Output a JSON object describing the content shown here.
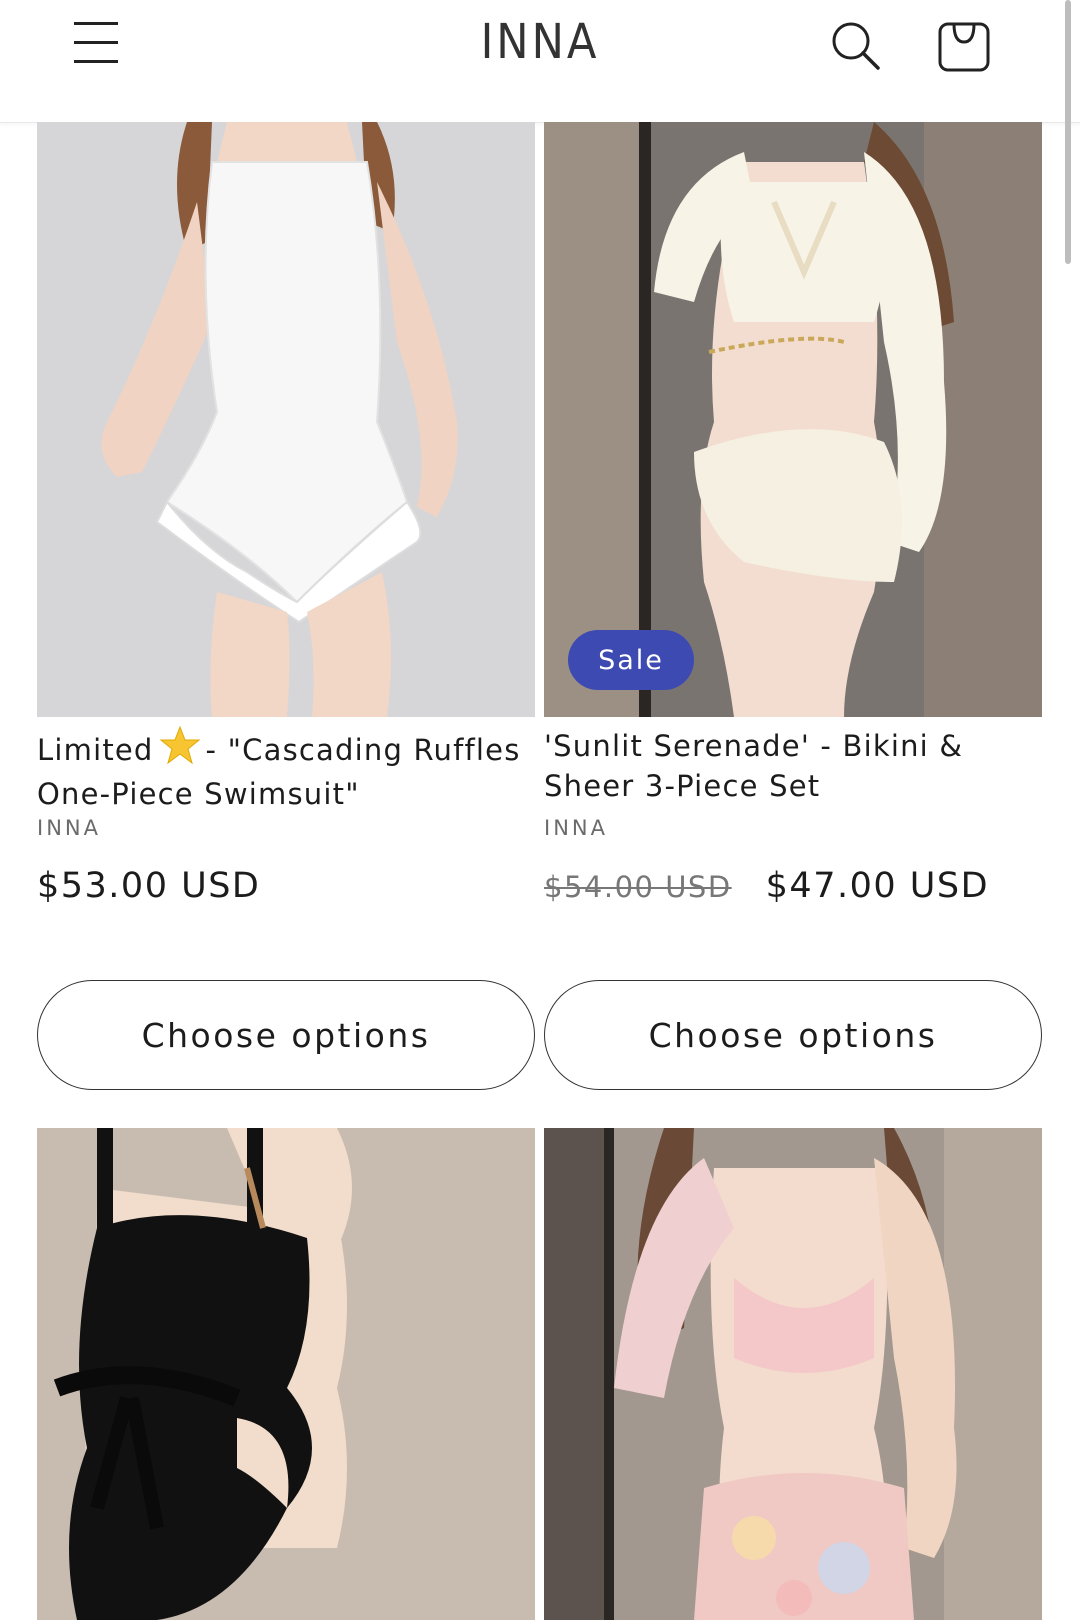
{
  "header": {
    "logo": "INNA",
    "menu_icon": "hamburger-menu-icon",
    "search_icon": "search-icon",
    "cart_icon": "cart-icon"
  },
  "products": [
    {
      "title_prefix": "Limited",
      "title_icon": "star-icon",
      "title_suffix": "- \"Cascading Ruffles One-Piece Swimsuit\"",
      "vendor": "INNA",
      "price": "$53.00 USD",
      "button": "Choose options"
    },
    {
      "badge": "Sale",
      "title": "'Sunlit Serenade' - Bikini & Sheer 3-Piece Set",
      "vendor": "INNA",
      "compare_price": "$54.00 USD",
      "price": "$47.00 USD",
      "button": "Choose options"
    },
    {},
    {}
  ],
  "colors": {
    "sale_badge": "#3c4ab2",
    "text": "#121212"
  }
}
